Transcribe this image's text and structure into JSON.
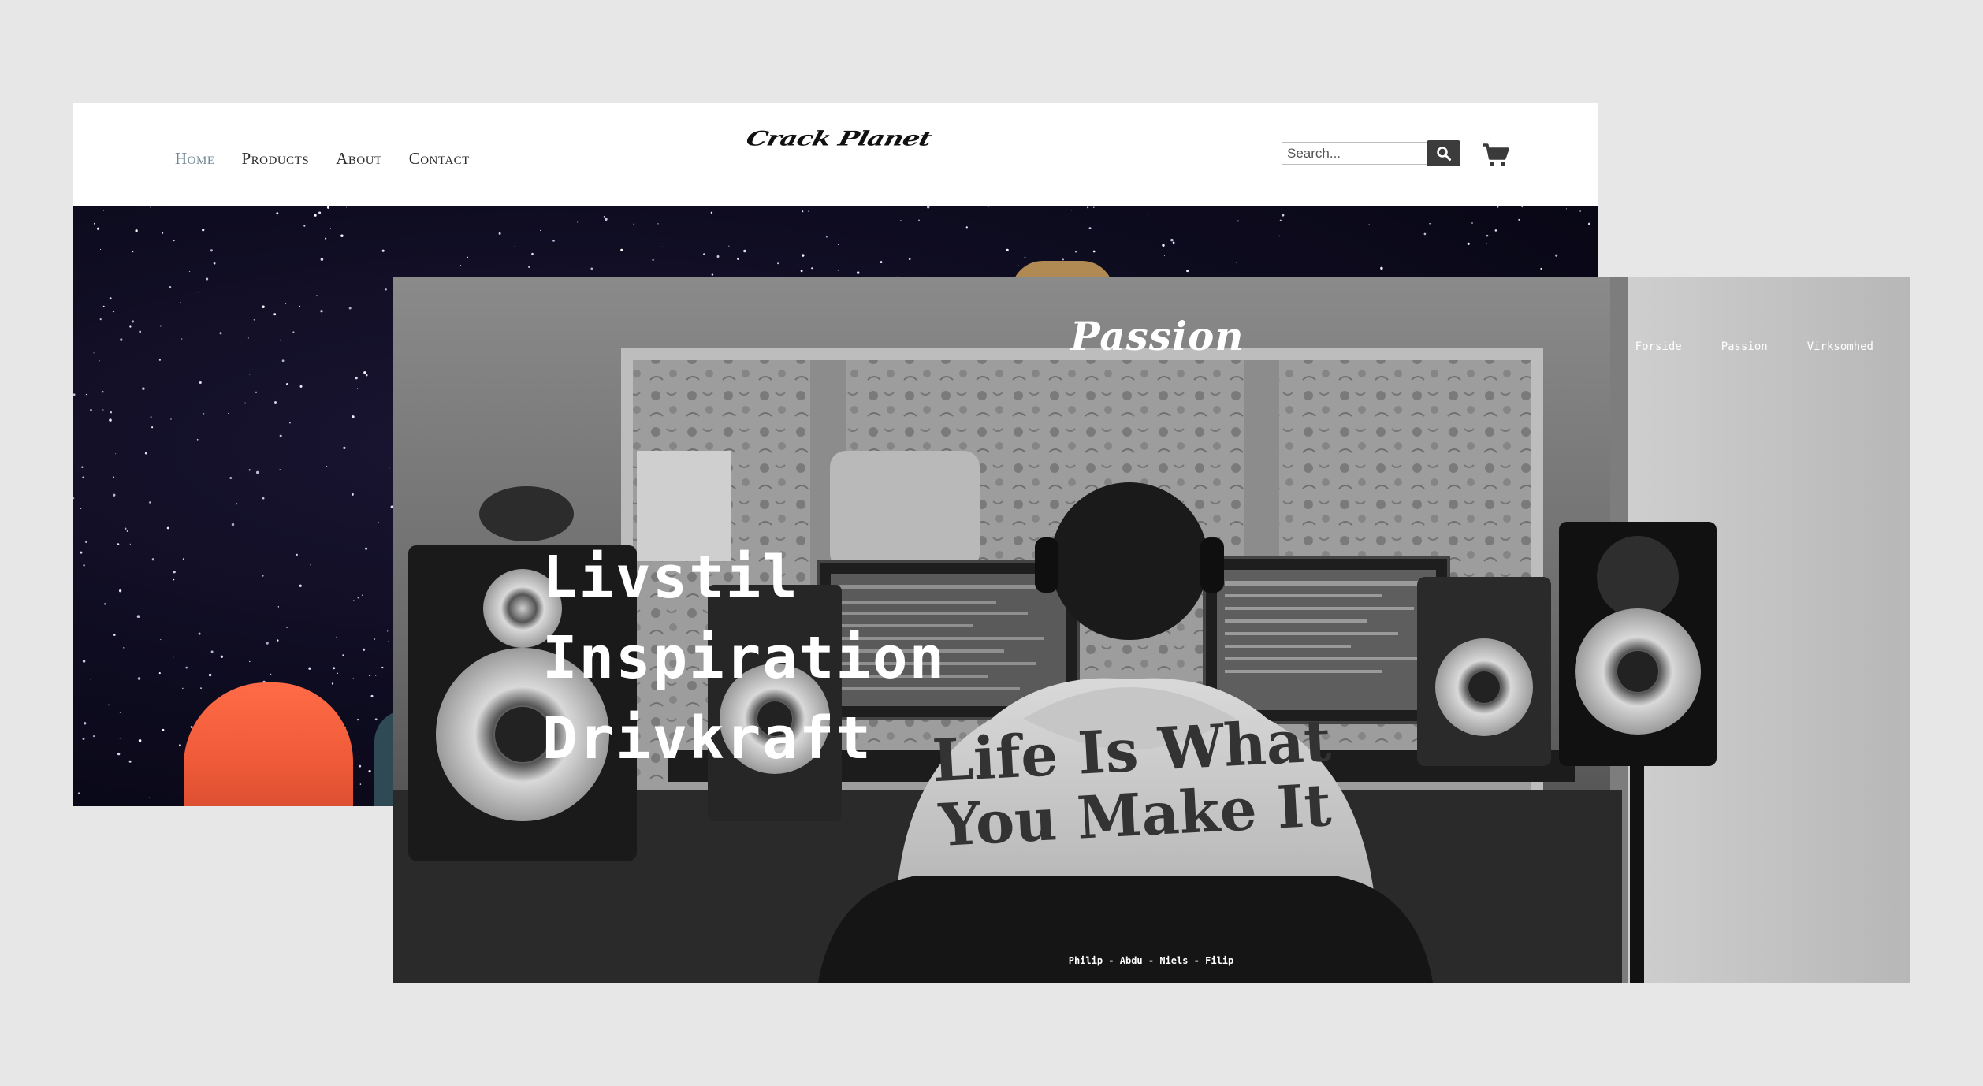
{
  "crack_planet": {
    "logo_text": "Crack Planet",
    "nav": [
      "Home",
      "Products",
      "About",
      "Contact"
    ],
    "active_nav": "Home",
    "search_placeholder": "Search...",
    "icons": {
      "search": "magnifier-icon",
      "cart": "shopping-cart-icon"
    }
  },
  "passion": {
    "title": "Passion",
    "nav": [
      "Forside",
      "Passion",
      "Virksomhed"
    ],
    "headline": [
      "Livstil",
      "Inspiration",
      "Drivkraft"
    ],
    "credits": "Philip - Abdu - Niels - Filip",
    "hoodie_text": [
      "Life Is What",
      "You Make It"
    ]
  },
  "colors": {
    "page_background": "#e7e7e7",
    "active_nav": "#6f8793",
    "space_background": "#0d0b1e",
    "beanie": "#ef5a38"
  }
}
